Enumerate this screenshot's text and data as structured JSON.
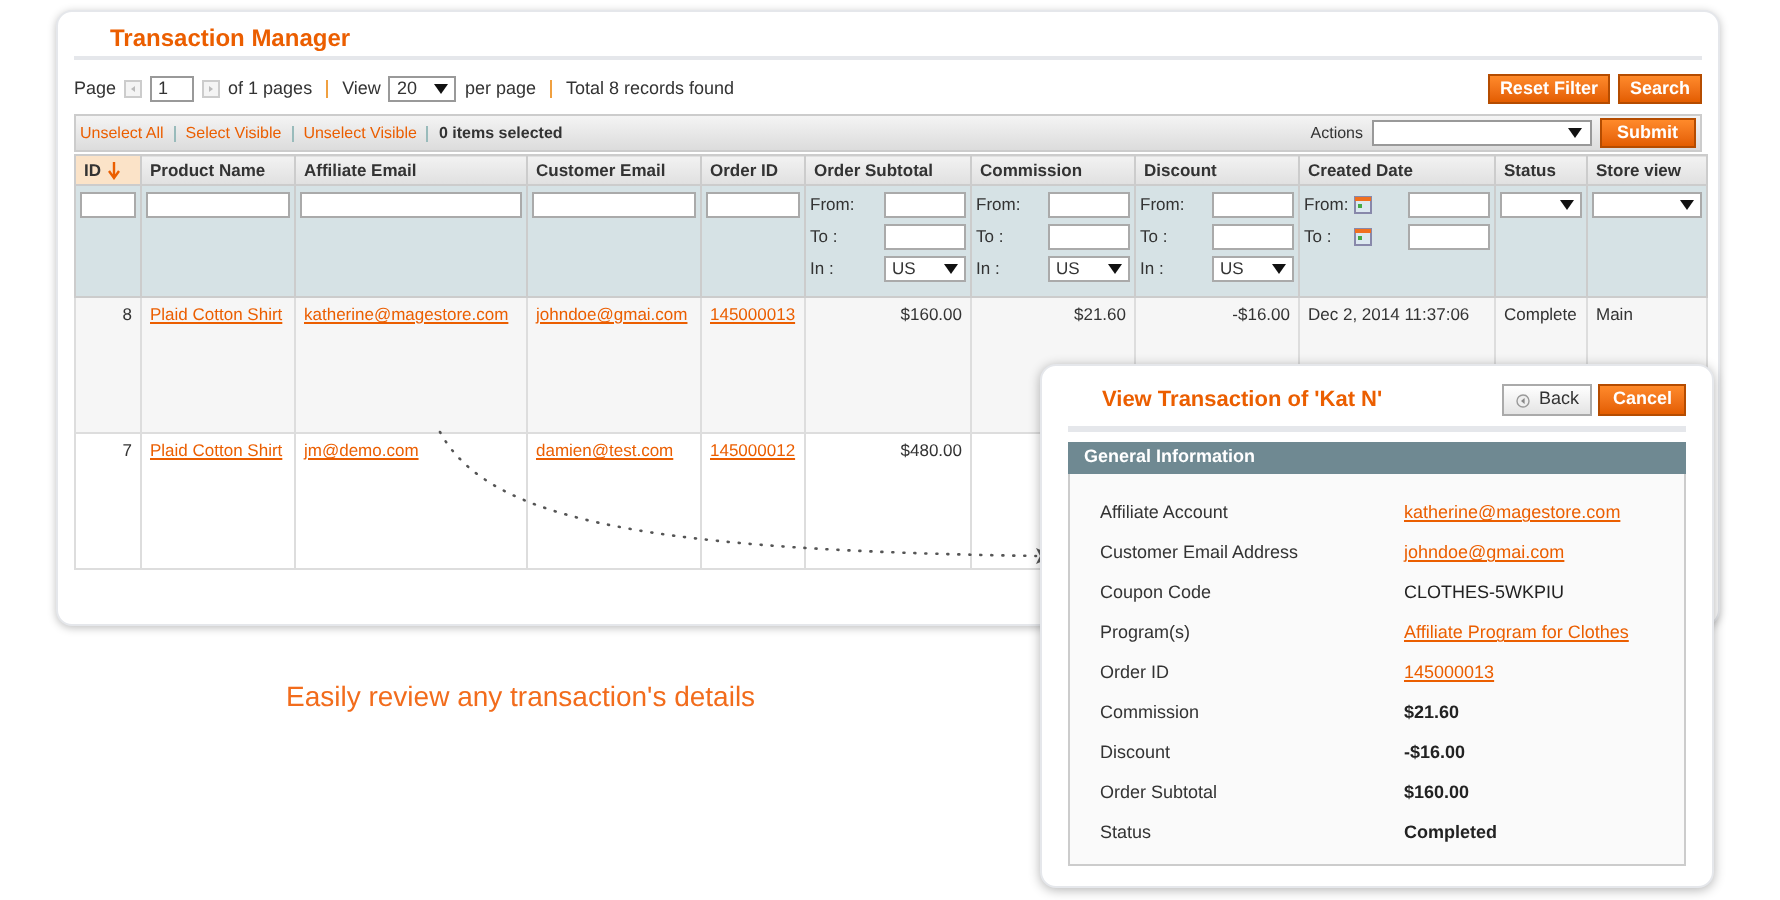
{
  "title": "Transaction Manager",
  "pager": {
    "page_label": "Page",
    "page": "1",
    "of_pages": "of 1 pages",
    "view_label": "View",
    "per_page": "20",
    "per_page_label": "per page",
    "total": "Total 8 records found"
  },
  "buttons": [
    "Reset Filter",
    "Search"
  ],
  "massaction": {
    "links": [
      "Unselect All",
      "Select Visible",
      "Unselect Visible"
    ],
    "count": "0 items selected",
    "actions_label": "Actions",
    "submit": "Submit"
  },
  "table": {
    "columns": [
      {
        "label": "ID",
        "sorted": true
      },
      {
        "label": "Product Name",
        "sorted": false
      },
      {
        "label": "Affiliate Email",
        "sorted": false
      },
      {
        "label": "Customer Email",
        "sorted": false
      },
      {
        "label": "Order ID",
        "sorted": false
      },
      {
        "label": "Order Subtotal",
        "sorted": false
      },
      {
        "label": "Commission",
        "sorted": false
      },
      {
        "label": "Discount",
        "sorted": false
      },
      {
        "label": "Created Date",
        "sorted": false
      },
      {
        "label": "Status",
        "sorted": false
      },
      {
        "label": "Store view",
        "sorted": false
      }
    ],
    "filters": [
      {
        "kind": "text"
      },
      {
        "kind": "text"
      },
      {
        "kind": "text"
      },
      {
        "kind": "text"
      },
      {
        "kind": "text"
      },
      {
        "kind": "range",
        "labels": [
          "From:",
          "To :",
          "In :"
        ],
        "currency": "US"
      },
      {
        "kind": "range",
        "labels": [
          "From:",
          "To :",
          "In :"
        ],
        "currency": "US"
      },
      {
        "kind": "range",
        "labels": [
          "From:",
          "To :",
          "In :"
        ],
        "currency": "US"
      },
      {
        "kind": "date",
        "labels": [
          "From:",
          "To :"
        ]
      },
      {
        "kind": "select"
      },
      {
        "kind": "select"
      }
    ],
    "rows": [
      {
        "cells": [
          {
            "kind": "number",
            "text": "8"
          },
          {
            "kind": "link",
            "text": "Plaid Cotton Shirt"
          },
          {
            "kind": "link",
            "text": "katherine@magestore.com"
          },
          {
            "kind": "link",
            "text": "johndoe@gmai.com"
          },
          {
            "kind": "link",
            "text": "145000013"
          },
          {
            "kind": "number",
            "text": "$160.00"
          },
          {
            "kind": "number",
            "text": "$21.60"
          },
          {
            "kind": "number",
            "text": "-$16.00"
          },
          {
            "kind": "text",
            "text": "Dec 2, 2014 11:37:06"
          },
          {
            "kind": "text",
            "text": "Complete"
          },
          {
            "kind": "text",
            "text": "Main"
          }
        ]
      },
      {
        "cells": [
          {
            "kind": "number",
            "text": "7"
          },
          {
            "kind": "link",
            "text": "Plaid Cotton Shirt"
          },
          {
            "kind": "link",
            "text": "jm@demo.com"
          },
          {
            "kind": "link",
            "text": "damien@test.com"
          },
          {
            "kind": "link",
            "text": "145000012"
          },
          {
            "kind": "number",
            "text": "$480.00"
          }
        ]
      }
    ]
  },
  "caption": "Easily review any transaction's details",
  "popup": {
    "title": "View Transaction of 'Kat N'",
    "back": "Back",
    "cancel": "Cancel",
    "section": "General Information",
    "fields": [
      {
        "label": "Affiliate Account",
        "value": "katherine@magestore.com",
        "kind": "link"
      },
      {
        "label": "Customer Email Address",
        "value": "johndoe@gmai.com",
        "kind": "link"
      },
      {
        "label": "Coupon Code",
        "value": "CLOTHES-5WKPIU",
        "kind": "text"
      },
      {
        "label": "Program(s)",
        "value": "Affiliate Program for Clothes",
        "kind": "link"
      },
      {
        "label": "Order ID",
        "value": "145000013",
        "kind": "link"
      },
      {
        "label": "Commission",
        "value": "$21.60",
        "kind": "bold"
      },
      {
        "label": "Discount",
        "value": "-$16.00",
        "kind": "bold"
      },
      {
        "label": "Order Subtotal",
        "value": "$160.00",
        "kind": "bold"
      },
      {
        "label": "Status",
        "value": "Completed",
        "kind": "bold"
      }
    ]
  }
}
